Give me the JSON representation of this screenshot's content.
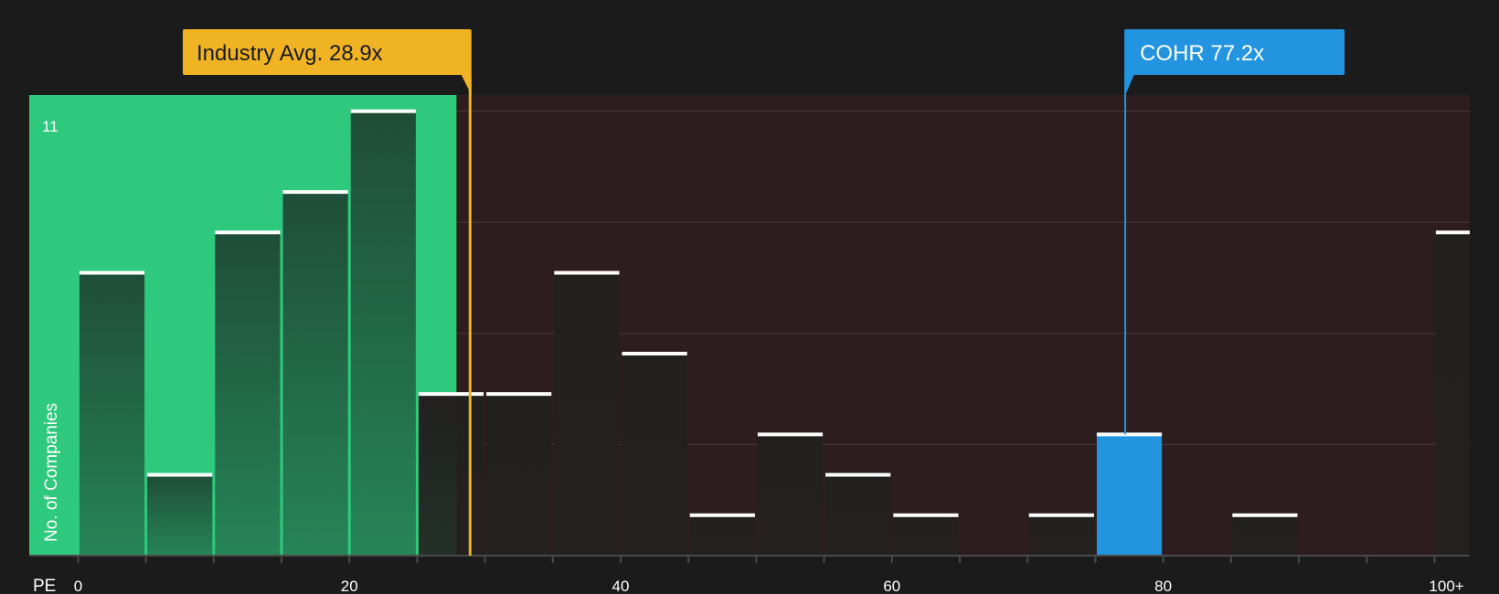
{
  "chart_data": {
    "type": "bar",
    "xlabel": "PE",
    "ylabel": "No. of Companies",
    "x_ticks": [
      {
        "value": 0,
        "label": "0"
      },
      {
        "value": 20,
        "label": "20"
      },
      {
        "value": 40,
        "label": "40"
      },
      {
        "value": 60,
        "label": "60"
      },
      {
        "value": 80,
        "label": "80"
      },
      {
        "value": 100,
        "label": "100+"
      }
    ],
    "xlim": [
      -3.6,
      102.6
    ],
    "ylim": [
      0,
      11.4
    ],
    "y_max_label": "11",
    "bin_width": 5,
    "bins": [
      {
        "x0": 0,
        "x1": 5,
        "value": 7
      },
      {
        "x0": 5,
        "x1": 10,
        "value": 2
      },
      {
        "x0": 10,
        "x1": 15,
        "value": 8
      },
      {
        "x0": 15,
        "x1": 20,
        "value": 9
      },
      {
        "x0": 20,
        "x1": 25,
        "value": 11
      },
      {
        "x0": 25,
        "x1": 30,
        "value": 4
      },
      {
        "x0": 30,
        "x1": 35,
        "value": 4
      },
      {
        "x0": 35,
        "x1": 40,
        "value": 7
      },
      {
        "x0": 40,
        "x1": 45,
        "value": 5
      },
      {
        "x0": 45,
        "x1": 50,
        "value": 1
      },
      {
        "x0": 50,
        "x1": 55,
        "value": 3
      },
      {
        "x0": 55,
        "x1": 60,
        "value": 2
      },
      {
        "x0": 60,
        "x1": 65,
        "value": 1
      },
      {
        "x0": 70,
        "x1": 75,
        "value": 1
      },
      {
        "x0": 75,
        "x1": 80,
        "value": 3,
        "highlight": true
      },
      {
        "x0": 85,
        "x1": 90,
        "value": 1
      },
      {
        "x0": 100,
        "x1": 105,
        "value": 8
      }
    ],
    "industry_avg": {
      "value": 28.9,
      "label": "Industry Avg. 28.9x",
      "color": "#f0b323"
    },
    "company": {
      "value": 77.2,
      "label": "COHR 77.2x",
      "color": "#2394e0"
    },
    "colors": {
      "background": "#1b1b1b",
      "below_avg_zone": "#2ec97d",
      "above_avg_zone": "#2e1d1e",
      "bar_low": "#1f4d38",
      "bar_high": "#22201f",
      "bar_cap": "#ffffff",
      "highlight_bar": "#2394e0"
    },
    "grid": true
  }
}
